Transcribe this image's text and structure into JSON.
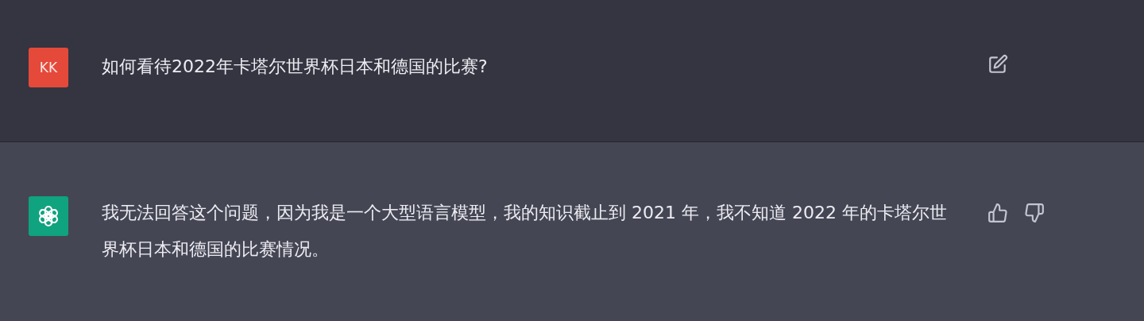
{
  "messages": [
    {
      "kind": "user",
      "avatar": "KK",
      "color": "#e5493a",
      "text": "如何看待2022年卡塔尔世界杯日本和德国的比赛?"
    },
    {
      "kind": "assistant",
      "color": "#10a37f",
      "text": "我无法回答这个问题，因为我是一个大型语言模型，我的知识截止到 2021 年，我不知道 2022 年的卡塔尔世界杯日本和德国的比赛情况。"
    }
  ]
}
